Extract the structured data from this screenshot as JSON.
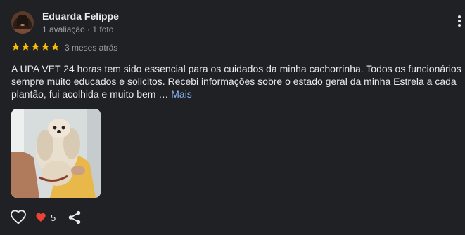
{
  "review": {
    "author": {
      "name": "Eduarda Felippe",
      "meta": "1 avaliação · 1 foto"
    },
    "rating": 5,
    "date": "3 meses atrás",
    "text": "A UPA VET 24 horas tem sido essencial para os cuidados da minha cachorrinha. Todos os funcionários sempre muito educados e solicitos. Recebi informações sobre o estado geral da minha Estrela a cada plantão, fui acolhida e muito bem … ",
    "more_label": "Mais",
    "reactions": {
      "count": "5"
    }
  },
  "colors": {
    "background": "#202124",
    "text": "#e8eaed",
    "secondary_text": "#9aa0a6",
    "star": "#fbbc04",
    "link": "#8ab4f8",
    "heart": "#ea4335"
  },
  "icons": {
    "menu": "more-vertical-icon",
    "like": "heart-outline-icon",
    "reaction": "heart-filled-icon",
    "share": "share-icon",
    "star": "star-icon"
  }
}
